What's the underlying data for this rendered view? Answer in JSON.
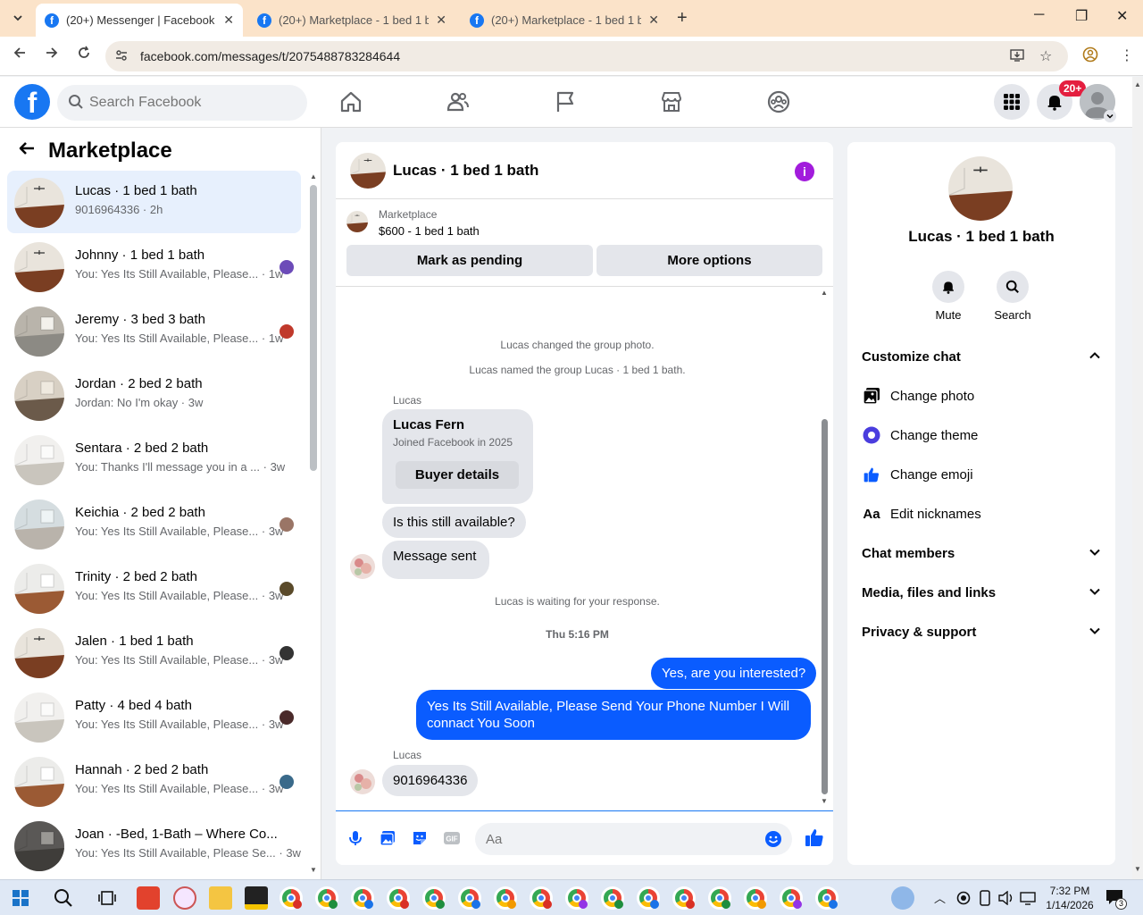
{
  "browser": {
    "tabs": [
      {
        "title": "(20+) Messenger | Facebook",
        "active": true
      },
      {
        "title": "(20+) Marketplace - 1 bed 1 bath",
        "active": false
      },
      {
        "title": "(20+) Marketplace - 1 bed 1 bath",
        "active": false
      }
    ],
    "url": "facebook.com/messages/t/2075488783284644"
  },
  "header": {
    "search_placeholder": "Search Facebook",
    "notifications_badge": "20+"
  },
  "sidebar": {
    "title": "Marketplace",
    "conversations": [
      {
        "name": "Lucas · 1 bed 1 bath",
        "preview": "9016964336 · 2h",
        "time": "",
        "selected": true,
        "thumb": "room1"
      },
      {
        "name": "Johnny · 1 bed 1 bath",
        "preview": "You: Yes Its Still Available, Please...",
        "time": "· 1w",
        "thumb": "room1",
        "mini": "#6c4bb8"
      },
      {
        "name": "Jeremy · 3 bed 3 bath",
        "preview": "You: Yes Its Still Available, Please...",
        "time": "· 1w",
        "thumb": "room2",
        "mini": "#c0392b"
      },
      {
        "name": "Jordan · 2 bed 2 bath",
        "preview": "Jordan: No I'm okay · 3w",
        "time": "",
        "thumb": "room3"
      },
      {
        "name": "Sentara · 2 bed 2 bath",
        "preview": "You: Thanks I'll message you in a ...",
        "time": "· 3w",
        "thumb": "room4"
      },
      {
        "name": "Keichia · 2 bed 2 bath",
        "preview": "You: Yes Its Still Available, Please...",
        "time": "· 3w",
        "thumb": "room5",
        "mini": "#9a7566"
      },
      {
        "name": "Trinity · 2 bed 2 bath",
        "preview": "You: Yes Its Still Available, Please...",
        "time": "· 3w",
        "thumb": "room6",
        "mini": "#5a4a2a"
      },
      {
        "name": "Jalen · 1 bed 1 bath",
        "preview": "You: Yes Its Still Available, Please...",
        "time": "· 3w",
        "thumb": "room1",
        "mini": "#333333"
      },
      {
        "name": "Patty · 4 bed 4 bath",
        "preview": "You: Yes Its Still Available, Please...",
        "time": "· 3w",
        "thumb": "room4",
        "mini": "#4a2a2a"
      },
      {
        "name": "Hannah · 2 bed 2 bath",
        "preview": "You: Yes Its Still Available, Please...",
        "time": "· 3w",
        "thumb": "room6",
        "mini": "#3a6a8a"
      },
      {
        "name": "Joan · -Bed, 1-Bath – Where Co...",
        "preview": "You: Yes Its Still Available, Please Se...",
        "time": "· 3w",
        "thumb": "room7"
      }
    ]
  },
  "chat": {
    "title": "Lucas · 1 bed 1 bath",
    "marketplace_label": "Marketplace",
    "listing": "$600 - 1 bed 1 bath",
    "mark_pending": "Mark as pending",
    "more_options": "More options",
    "sys_photo": "Lucas changed the group photo.",
    "sys_named": "Lucas named the group Lucas · 1 bed 1 bath.",
    "sender_1": "Lucas",
    "card_name": "Lucas Fern",
    "card_sub": "Joined Facebook in 2025",
    "card_button": "Buyer details",
    "msg_available": "Is this still available?",
    "msg_sent": "Message sent",
    "sys_waiting": "Lucas is waiting for your response.",
    "timestamp": "Thu 5:16 PM",
    "out_1": "Yes, are you interested?",
    "out_2": "Yes Its Still Available, Please Send Your Phone Number I Will connact You Soon",
    "sender_2": "Lucas",
    "msg_phone": "9016964336",
    "composer_placeholder": "Aa"
  },
  "right_panel": {
    "name": "Lucas · 1 bed 1 bath",
    "mute": "Mute",
    "search": "Search",
    "customize": "Customize chat",
    "change_photo": "Change photo",
    "change_theme": "Change theme",
    "change_emoji": "Change emoji",
    "edit_nicknames": "Edit nicknames",
    "nickname_icon_text": "Aa",
    "chat_members": "Chat members",
    "media": "Media, files and links",
    "privacy": "Privacy & support"
  },
  "taskbar": {
    "time": "7:32 PM",
    "date": "1/14/2026",
    "notif_count": "3"
  },
  "colors": {
    "accent": "#0a5cff",
    "fb_blue": "#1877f2",
    "theme_purple": "#a21cdc",
    "badge_red": "#e41e3f"
  }
}
